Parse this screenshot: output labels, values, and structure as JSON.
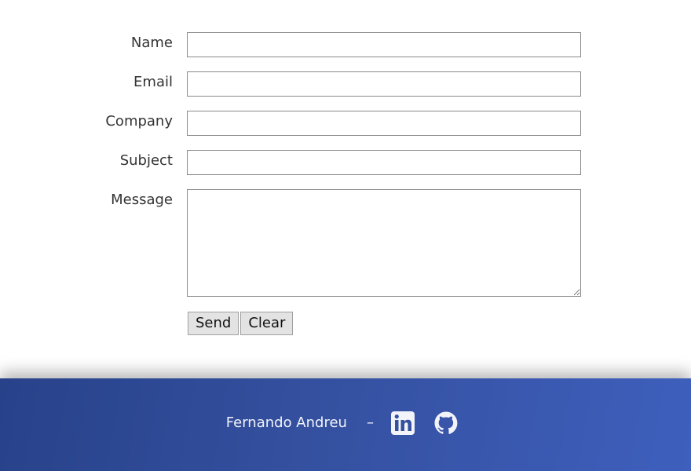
{
  "form": {
    "fields": [
      {
        "label": "Name",
        "value": "",
        "placeholder": ""
      },
      {
        "label": "Email",
        "value": "",
        "placeholder": ""
      },
      {
        "label": "Company",
        "value": "",
        "placeholder": ""
      },
      {
        "label": "Subject",
        "value": "",
        "placeholder": ""
      }
    ],
    "message": {
      "label": "Message",
      "value": "",
      "placeholder": ""
    },
    "send_label": "Send",
    "clear_label": "Clear"
  },
  "footer": {
    "name": "Fernando Andreu",
    "separator": "–",
    "icons": [
      "linkedin-icon",
      "github-icon"
    ],
    "background_colors": [
      "#28428a",
      "#3e5fbd"
    ],
    "text_color": "#f2f4fa"
  }
}
